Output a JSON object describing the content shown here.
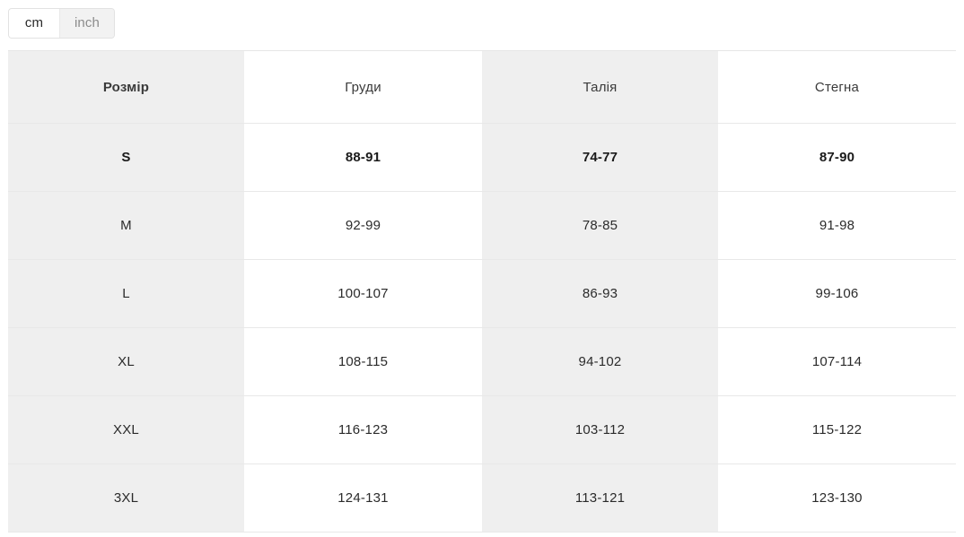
{
  "units": {
    "options": [
      {
        "id": "cm",
        "label": "cm",
        "active": true
      },
      {
        "id": "inch",
        "label": "inch",
        "active": false
      }
    ],
    "selected": "cm"
  },
  "table": {
    "headers": [
      "Розмір",
      "Груди",
      "Талія",
      "Стегна"
    ],
    "highlighted_row_index": 0,
    "rows": [
      {
        "size": "S",
        "chest": "88-91",
        "waist": "74-77",
        "hips": "87-90"
      },
      {
        "size": "M",
        "chest": "92-99",
        "waist": "78-85",
        "hips": "91-98"
      },
      {
        "size": "L",
        "chest": "100-107",
        "waist": "86-93",
        "hips": "99-106"
      },
      {
        "size": "XL",
        "chest": "108-115",
        "waist": "94-102",
        "hips": "107-114"
      },
      {
        "size": "XXL",
        "chest": "116-123",
        "waist": "103-112",
        "hips": "115-122"
      },
      {
        "size": "3XL",
        "chest": "124-131",
        "waist": "113-121",
        "hips": "123-130"
      }
    ]
  },
  "colors": {
    "shade": "#efefef",
    "plain": "#ffffff",
    "border": "#e8e8e8",
    "text": "#2b2b2b",
    "muted_text": "#8c8c8c",
    "toggle_inactive_bg": "#f2f2f2"
  }
}
